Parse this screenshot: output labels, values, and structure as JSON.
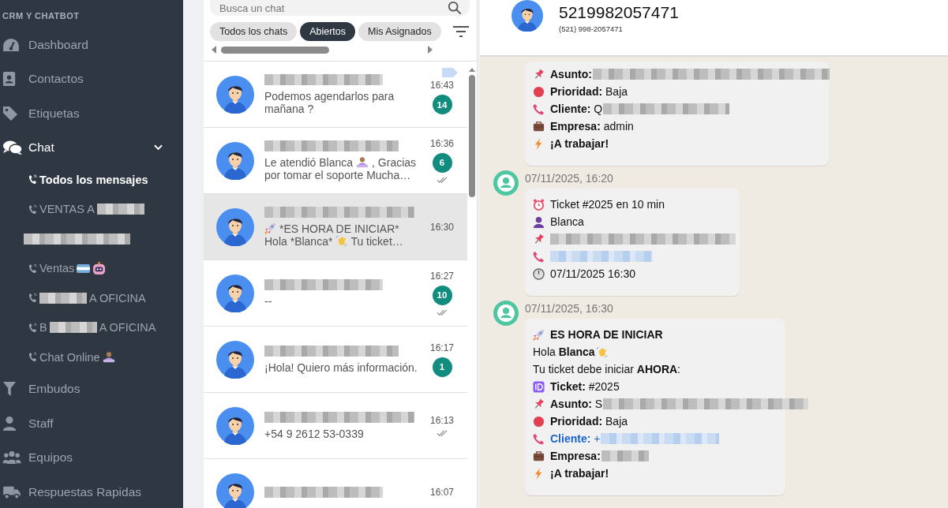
{
  "sidebar": {
    "heading": "CRM Y CHATBOT",
    "items": [
      {
        "label": "Dashboard",
        "selected": false
      },
      {
        "label": "Contactos",
        "selected": false
      },
      {
        "label": "Etiquetas",
        "selected": false
      },
      {
        "label": "Chat",
        "selected": true,
        "expanded": true,
        "children": [
          {
            "text_before": "Todos los mensajes",
            "phone_icon": true,
            "redacted": false,
            "selected": true
          },
          {
            "text_before": "VENTAS A",
            "phone_icon": true,
            "redacted": true,
            "selected": false
          },
          {
            "phone_icon": false,
            "redacted": true,
            "selected": false
          },
          {
            "text_before": "Ventas",
            "phone_icon": true,
            "redacted": false,
            "selected": false
          },
          {
            "phone_icon": true,
            "redacted": true,
            "text_after": "A OFICINA",
            "selected": false
          },
          {
            "text_before": "B",
            "phone_icon": true,
            "redacted": true,
            "text_after": "A OFICINA",
            "selected": false
          },
          {
            "text_before": "Chat Online",
            "phone_icon": true,
            "redacted": false,
            "selected": false
          }
        ]
      },
      {
        "label": "Embudos",
        "selected": false
      },
      {
        "label": "Staff",
        "selected": false
      },
      {
        "label": "Equipos",
        "selected": false
      },
      {
        "label": "Respuestas Rapidas",
        "selected": false
      }
    ]
  },
  "chat_list": {
    "search": {
      "placeholder": "Busca un chat"
    },
    "filters": [
      {
        "label": "Todos los chats",
        "selected": false
      },
      {
        "label": "Abiertos",
        "selected": true
      },
      {
        "label": "Mis Asignados",
        "selected": false
      }
    ],
    "chats": [
      {
        "preview": [
          "Podemos agendarlos para mañana ?"
        ],
        "time": "16:43",
        "unread": "14",
        "read": false,
        "tagged": true,
        "selected": false
      },
      {
        "preview": [
          "Le atendió Blanca",
          ", Gracias",
          "por tomar el soporte Mucha…"
        ],
        "time": "16:36",
        "unread": "6",
        "read": true,
        "tagged": false,
        "selected": false
      },
      {
        "preview": [
          "*ES HORA DE INICIAR*",
          "Hola *Blanca*",
          "Tu ticket…"
        ],
        "time": "16:30",
        "read": false,
        "tagged": false,
        "selected": true
      },
      {
        "preview": [
          "--"
        ],
        "time": "16:27",
        "unread": "10",
        "read": true,
        "tagged": false,
        "selected": false
      },
      {
        "preview": [
          "¡Hola! Quiero más información."
        ],
        "time": "16:17",
        "unread": "1",
        "read": false,
        "tagged": false,
        "selected": false
      },
      {
        "preview": [
          "+54 9 2612 53-0339"
        ],
        "time": "16:13",
        "read": true,
        "tagged": false,
        "selected": false
      },
      {
        "time": "16:07",
        "read": false,
        "tagged": false,
        "selected": false
      }
    ]
  },
  "conversation": {
    "contact": {
      "name": "5219982057471",
      "phone": "(521) 998-2057471"
    },
    "messages": [
      {
        "lines": [
          {
            "text": "**Asunto:** ",
            "redacted": true,
            "bold": false,
            "link": false
          },
          {
            "text": "**Prioridad:** Baja",
            "redacted": false,
            "bold": false,
            "link": false
          },
          {
            "text": "**Cliente:** Q",
            "redacted": true,
            "bold": false,
            "link": false
          },
          {
            "text": "**Empresa:** admin",
            "redacted": false,
            "bold": false,
            "link": false
          },
          {
            "text": "¡A trabajar!",
            "bold": true,
            "redacted": false,
            "link": false
          }
        ]
      },
      {
        "timestamp": "07/11/2025, 16:20",
        "lines": [
          {
            "text": "Ticket #2025 en 10 min",
            "redacted": false,
            "bold": false,
            "link": false
          },
          {
            "text": "Blanca",
            "redacted": false,
            "bold": false,
            "link": false
          },
          {
            "redacted": true,
            "bold": false,
            "link": false
          },
          {
            "redacted": true,
            "bold": false,
            "link": true
          },
          {
            "text": "07/11/2025 16:30",
            "redacted": false,
            "bold": false,
            "link": false
          }
        ]
      },
      {
        "timestamp": "07/11/2025, 16:30",
        "lines": [
          {
            "text": "ES HORA DE INICIAR",
            "bold": true,
            "redacted": false,
            "link": false
          },
          {
            "text": "Hola **Blanca**",
            "redacted": false,
            "bold": false,
            "link": false
          },
          {
            "text": "Tu ticket debe iniciar **AHORA**:",
            "redacted": false,
            "bold": false,
            "link": false
          },
          {
            "text": "**Ticket:** #2025",
            "redacted": false,
            "bold": false,
            "link": false
          },
          {
            "text": "**Asunto:** S",
            "redacted": true,
            "bold": false,
            "link": false
          },
          {
            "text": "**Prioridad:** Baja",
            "redacted": false,
            "bold": false,
            "link": false
          },
          {
            "text": "**Cliente:** +",
            "redacted": true,
            "bold": false,
            "link": true
          },
          {
            "text": "**Empresa:** ",
            "redacted": true,
            "bold": false,
            "link": false
          },
          {
            "text": "¡A trabajar!",
            "bold": true,
            "redacted": false,
            "link": false
          }
        ]
      }
    ]
  }
}
